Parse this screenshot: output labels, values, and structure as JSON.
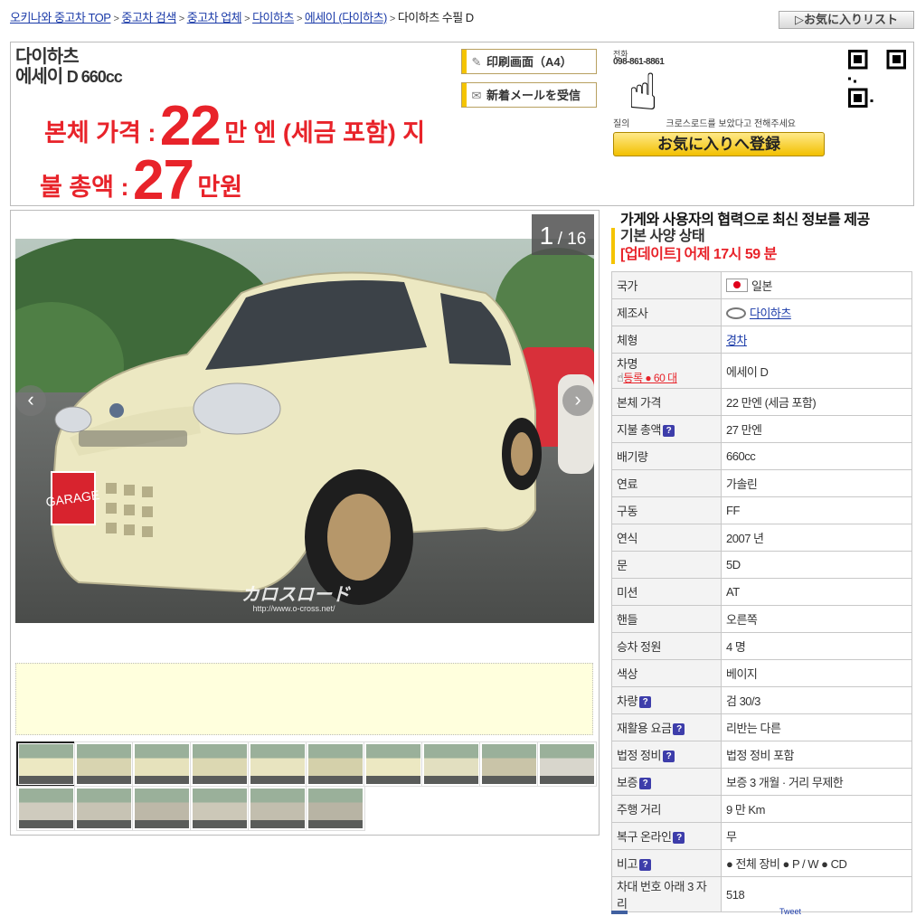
{
  "breadcrumb": [
    {
      "label": "오키나와 중고차 TOP",
      "link": true
    },
    {
      "label": "중고차 검색",
      "link": true
    },
    {
      "label": "중고차 업체",
      "link": true
    },
    {
      "label": "다이하츠",
      "link": true
    },
    {
      "label": "에세이 (다이하츠)",
      "link": true
    },
    {
      "label": "다이하츠 수필 D",
      "link": false
    }
  ],
  "header": {
    "fav_list_label": "▷お気に入りリスト",
    "maker": "다이하츠",
    "model": "에세이",
    "model_suffix": "D 660cc",
    "price1_label_a": "본체 가격 :",
    "price1_value": "22",
    "price1_label_b": "만 엔 (세금 포함) 지",
    "price2_label_a": "불 총액 :",
    "price2_value": "27",
    "price2_label_b": "만원",
    "print_label": "印刷画面（A4）",
    "mail_label": "新着メールを受信",
    "tel_label": "전화",
    "tel_number": "098-861-8861",
    "inquiry_a": "질의",
    "inquiry_b": "크로스로드를 보았다고 전해주세요",
    "fav_add_label": "お気に入りへ登録"
  },
  "gallery": {
    "current": "1",
    "total": "/ 16",
    "watermark": "カロスロード",
    "watermark_url": "http://www.o-cross.net/",
    "plate_text": "GARAGE",
    "thumb_count": 16,
    "selected": 0
  },
  "spec": {
    "tagline": "가게와 사용자의 협력으로 최신 정보를 제공",
    "title": "기본 사양 상태",
    "update": "[업데이트] 어제 17시 59 분",
    "country_value": "일본",
    "maker_value": "다이하츠",
    "body_value": "경차",
    "name_label": "차명",
    "reg_count": "등록 ● 60 대",
    "name_value": "에세이 D",
    "rows": [
      {
        "k": "국가"
      },
      {
        "k": "제조사"
      },
      {
        "k": "체형"
      },
      {
        "k": "본체 가격",
        "v": "22 만엔 (세금 포함)"
      },
      {
        "k": "지불 총액",
        "q": true,
        "v": "27 만엔"
      },
      {
        "k": "배기량",
        "v": "660cc"
      },
      {
        "k": "연료",
        "v": "가솔린"
      },
      {
        "k": "구동",
        "v": "FF"
      },
      {
        "k": "연식",
        "v": "2007 년"
      },
      {
        "k": "문",
        "v": "5D"
      },
      {
        "k": "미션",
        "v": "AT"
      },
      {
        "k": "핸들",
        "v": "오른쪽"
      },
      {
        "k": "승차 정원",
        "v": "4 명"
      },
      {
        "k": "색상",
        "v": "베이지"
      },
      {
        "k": "차량",
        "q": true,
        "v": "검 30/3"
      },
      {
        "k": "재활용 요금",
        "q": true,
        "v": "리반는 다른"
      },
      {
        "k": "법정 정비",
        "q": true,
        "v": "법정 정비 포함"
      },
      {
        "k": "보증",
        "q": true,
        "v": "보증 3 개월 · 거리 무제한"
      },
      {
        "k": "주행 거리",
        "v": "9 만 Km"
      },
      {
        "k": "복구 온라인",
        "q": true,
        "v": "무"
      },
      {
        "k": "비고",
        "q": true,
        "v": "● 전체 장비 ● P / W ● CD"
      },
      {
        "k": "차대 번호 아래 3 자리",
        "v": "518"
      }
    ],
    "footer_peek": "Tweet"
  },
  "colors": {
    "price_red": "#e8232a",
    "car_body": "#ece8c2",
    "accent_yellow": "#f5c400"
  }
}
